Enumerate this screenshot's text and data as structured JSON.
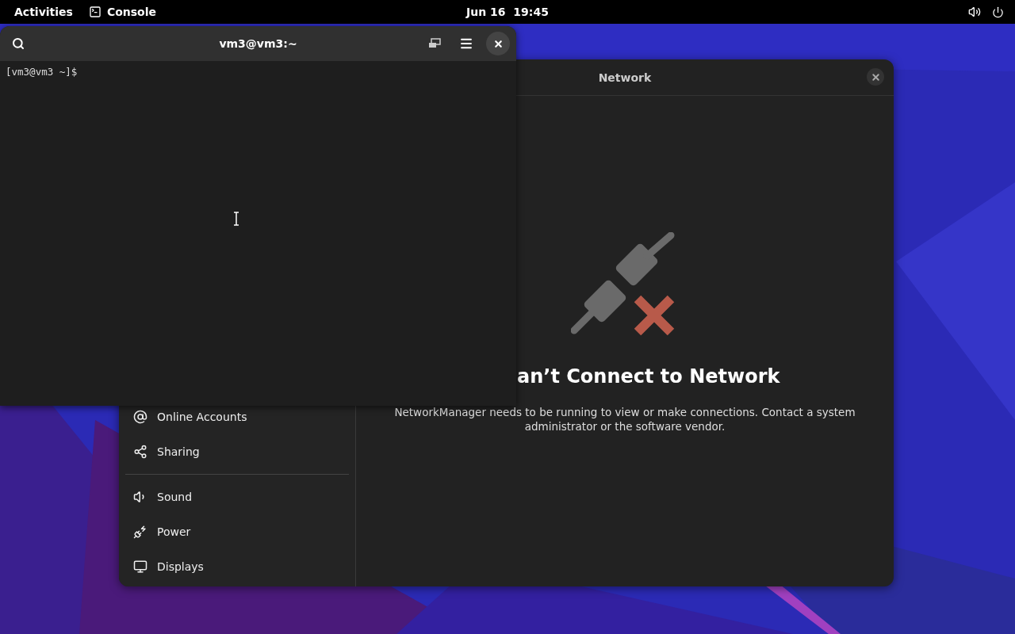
{
  "top_bar": {
    "activities": "Activities",
    "app_menu": "Console",
    "clock": "Jun 16  19:45"
  },
  "terminal": {
    "title": "vm3@vm3:~",
    "prompt": "[vm3@vm3 ~]$"
  },
  "settings": {
    "panel_title": "Network",
    "sidebar": {
      "groups": [
        {
          "items": [
            {
              "label": "Online Accounts"
            },
            {
              "label": "Sharing"
            }
          ]
        },
        {
          "items": [
            {
              "label": "Sound"
            },
            {
              "label": "Power"
            },
            {
              "label": "Displays"
            }
          ]
        }
      ]
    },
    "message": {
      "heading": "an’t Connect to Network",
      "text": "NetworkManager needs to be running to view or make connections. Contact a system administrator or the software vendor."
    }
  }
}
